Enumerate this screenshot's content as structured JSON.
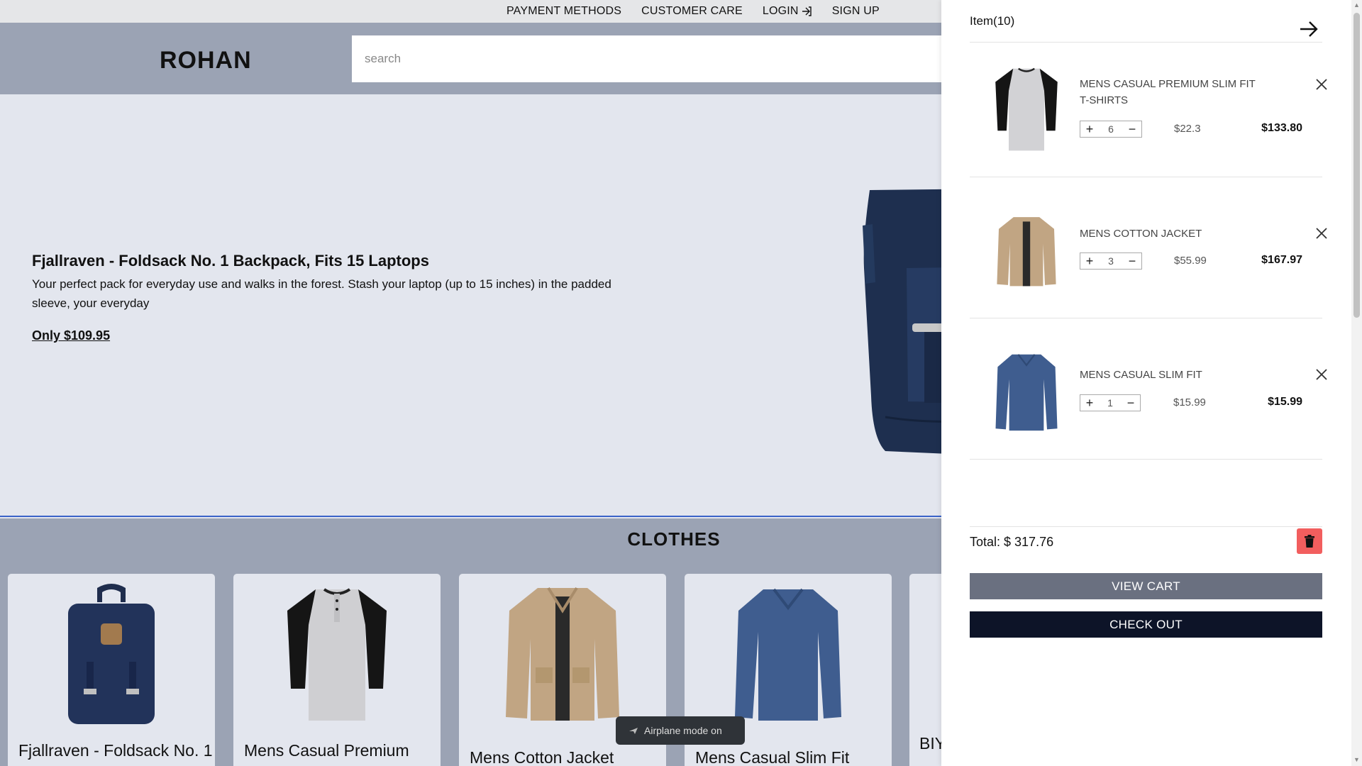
{
  "topbar": {
    "payment": "PAYMENT METHODS",
    "care": "CUSTOMER CARE",
    "login": "LOGIN",
    "signup": "SIGN UP"
  },
  "header": {
    "logo": "ROHAN",
    "search_placeholder": "search"
  },
  "hero": {
    "title": "Fjallraven - Foldsack No. 1 Backpack, Fits 15 Laptops",
    "description": "Your perfect pack for everyday use and walks in the forest. Stash your laptop (up to 15 inches) in the padded sleeve, your everyday",
    "price": "Only $109.95"
  },
  "clothes": {
    "title": "CLOTHES",
    "cards": [
      {
        "name": "Fjallraven - Foldsack No. 1"
      },
      {
        "name": "Mens Casual Premium"
      },
      {
        "name": "Mens Cotton Jacket"
      },
      {
        "name": "Mens Casual Slim Fit"
      },
      {
        "name": "BIY"
      }
    ]
  },
  "toast": {
    "text": "Airplane mode on"
  },
  "cart": {
    "title": "Item(10)",
    "items": [
      {
        "name": "MENS CASUAL PREMIUM SLIM FIT T-SHIRTS",
        "qty": "6",
        "unit_price": "$22.3",
        "line_total": "$133.80"
      },
      {
        "name": "MENS COTTON JACKET",
        "qty": "3",
        "unit_price": "$55.99",
        "line_total": "$167.97"
      },
      {
        "name": "MENS CASUAL SLIM FIT",
        "qty": "1",
        "unit_price": "$15.99",
        "line_total": "$15.99"
      }
    ],
    "total": "Total: $ 317.76",
    "view_cart": "VIEW CART",
    "check_out": "CHECK OUT"
  },
  "colors": {
    "header_bg": "#9ba3b4",
    "page_bg": "#e3e6ee",
    "trash_bg": "#f25e5e",
    "view_cart_bg": "#6a7080",
    "checkout_bg": "#0d1428"
  }
}
